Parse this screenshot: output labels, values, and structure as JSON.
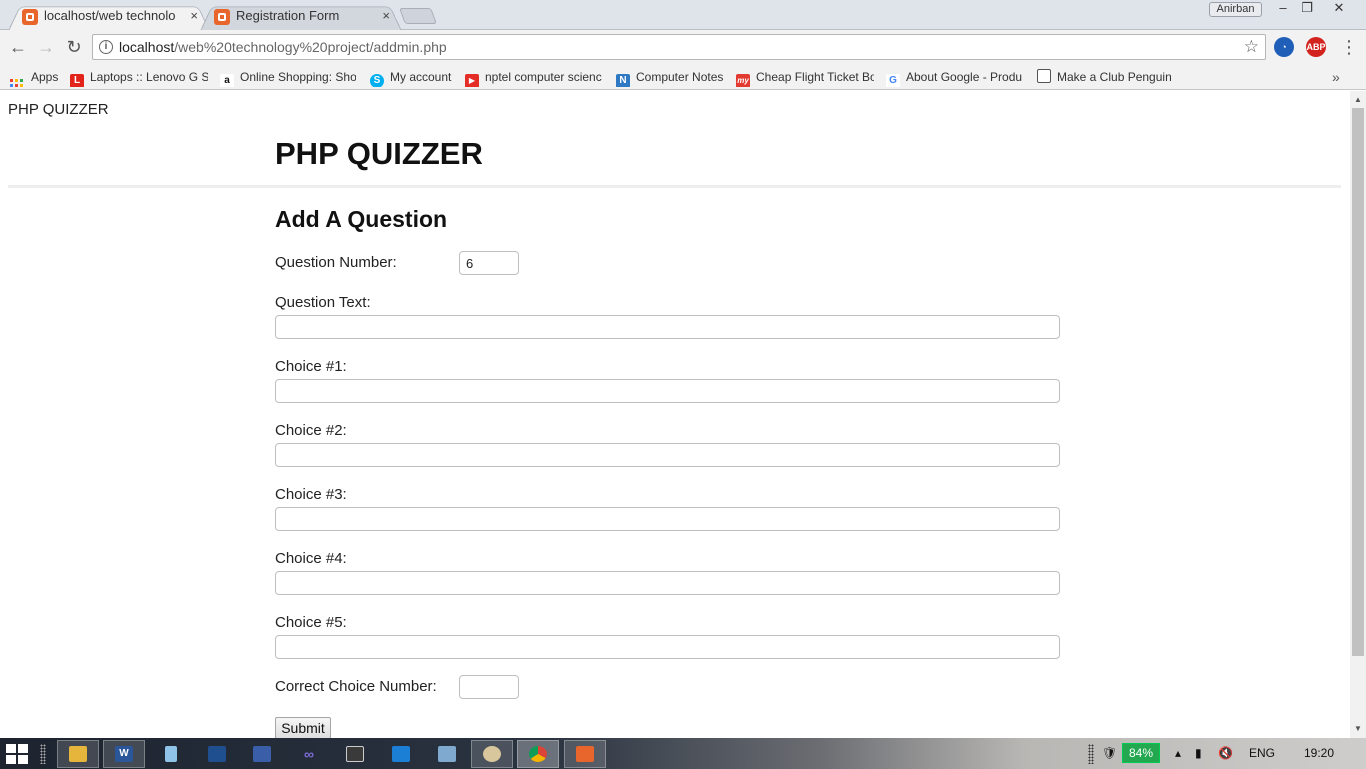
{
  "browser": {
    "tabs": [
      {
        "label": "localhost/web technolog",
        "active": true
      },
      {
        "label": "Registration Form",
        "active": false
      }
    ],
    "close_glyph": "×",
    "user_name": "Anirban",
    "window_controls": {
      "minimize": "–",
      "restore": "❐",
      "close": "✕"
    },
    "url_host": "localhost",
    "url_path": "/web%20technology%20project/addmin.php",
    "extensions": [
      "cast-icon",
      "abp-icon"
    ],
    "abp_label": "ABP"
  },
  "bookmarks": {
    "items": [
      {
        "label": "Apps",
        "icon": "apps-icon"
      },
      {
        "label": "Laptops :: Lenovo G S",
        "icon": "lenovo-icon",
        "icon_text": "L",
        "color": "#e2231a"
      },
      {
        "label": "Online Shopping: Sho",
        "icon": "amazon-icon",
        "icon_text": "a",
        "color": "#ffffff"
      },
      {
        "label": "My account",
        "icon": "skype-icon",
        "icon_text": "S",
        "color": "#00aff0"
      },
      {
        "label": "nptel computer scienc",
        "icon": "youtube-icon",
        "icon_text": "▶",
        "color": "#e52d27"
      },
      {
        "label": "Computer Notes",
        "icon": "notes-icon",
        "icon_text": "N",
        "color": "#2f78c4"
      },
      {
        "label": "Cheap Flight Ticket Bo",
        "icon": "makemytrip-icon",
        "icon_text": "my",
        "color": "#e23a31"
      },
      {
        "label": "About Google - Produ",
        "icon": "google-icon",
        "icon_text": "G",
        "color": "#ffffff"
      },
      {
        "label": "Make a Club Penguin",
        "icon": "folder-icon",
        "icon_text": "",
        "color": "#ffffff"
      }
    ],
    "more": "»"
  },
  "page": {
    "site_title": "PHP QUIZZER",
    "main_heading": "PHP QUIZZER",
    "sub_heading": "Add A Question",
    "question_number_label": "Question Number:",
    "question_number_value": "6",
    "question_text_label": "Question Text:",
    "choice_labels": [
      "Choice #1:",
      "Choice #2:",
      "Choice #3:",
      "Choice #4:",
      "Choice #5:"
    ],
    "correct_choice_label": "Correct Choice Number:",
    "submit_label": "Submit"
  },
  "taskbar": {
    "apps": [
      "file-explorer-icon",
      "word-icon",
      "notepad-icon",
      "photos-icon",
      "monitor-icon",
      "infinity-icon",
      "media-icon",
      "onenote-icon",
      "image-viewer-icon",
      "paint-icon",
      "chrome-icon",
      "xampp-icon"
    ],
    "battery": "84%",
    "language": "ENG",
    "time": "19:20"
  }
}
